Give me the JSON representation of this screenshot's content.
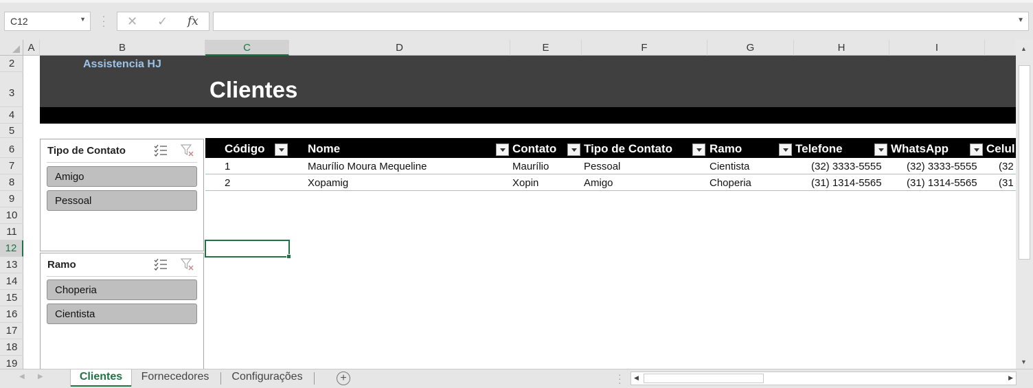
{
  "formula_bar": {
    "name_box": "C12",
    "cancel_icon": "✕",
    "enter_icon": "✓",
    "function_icon": "fx",
    "formula": ""
  },
  "columns": [
    "A",
    "B",
    "C",
    "D",
    "E",
    "F",
    "G",
    "H",
    "I"
  ],
  "selected_column": "C",
  "rows": [
    "2",
    "3",
    "4",
    "5",
    "6",
    "7",
    "8",
    "9",
    "10",
    "11",
    "12",
    "13",
    "14",
    "15",
    "16",
    "17",
    "18",
    "19"
  ],
  "selected_row": "12",
  "sheet": {
    "brand": "Assistencia HJ",
    "title": "Clientes"
  },
  "table": {
    "headers": [
      "Código",
      "Nome",
      "Contato",
      "Tipo de Contato",
      "Ramo",
      "Telefone",
      "WhatsApp",
      "Celul"
    ],
    "rows": [
      [
        "1",
        "Maurílio Moura Mequeline",
        "Maurílio",
        "Pessoal",
        "Cientista",
        "(32) 3333-5555",
        "(32) 3333-5555",
        "(32"
      ],
      [
        "2",
        "Xopamig",
        "Xopin",
        "Amigo",
        "Choperia",
        "(31) 1314-5565",
        "(31) 1314-5565",
        "(31"
      ]
    ]
  },
  "slicers": [
    {
      "title": "Tipo de Contato",
      "items": [
        "Amigo",
        "Pessoal"
      ]
    },
    {
      "title": "Ramo",
      "items": [
        "Choperia",
        "Cientista"
      ]
    }
  ],
  "tabs": [
    {
      "label": "Clientes",
      "active": true
    },
    {
      "label": "Fornecedores",
      "active": false
    },
    {
      "label": "Configurações",
      "active": false
    }
  ],
  "colors": {
    "accent": "#217346",
    "banner": "#404040",
    "brand_text": "#9dc3e6",
    "slicer_item": "#bfbfbf"
  }
}
